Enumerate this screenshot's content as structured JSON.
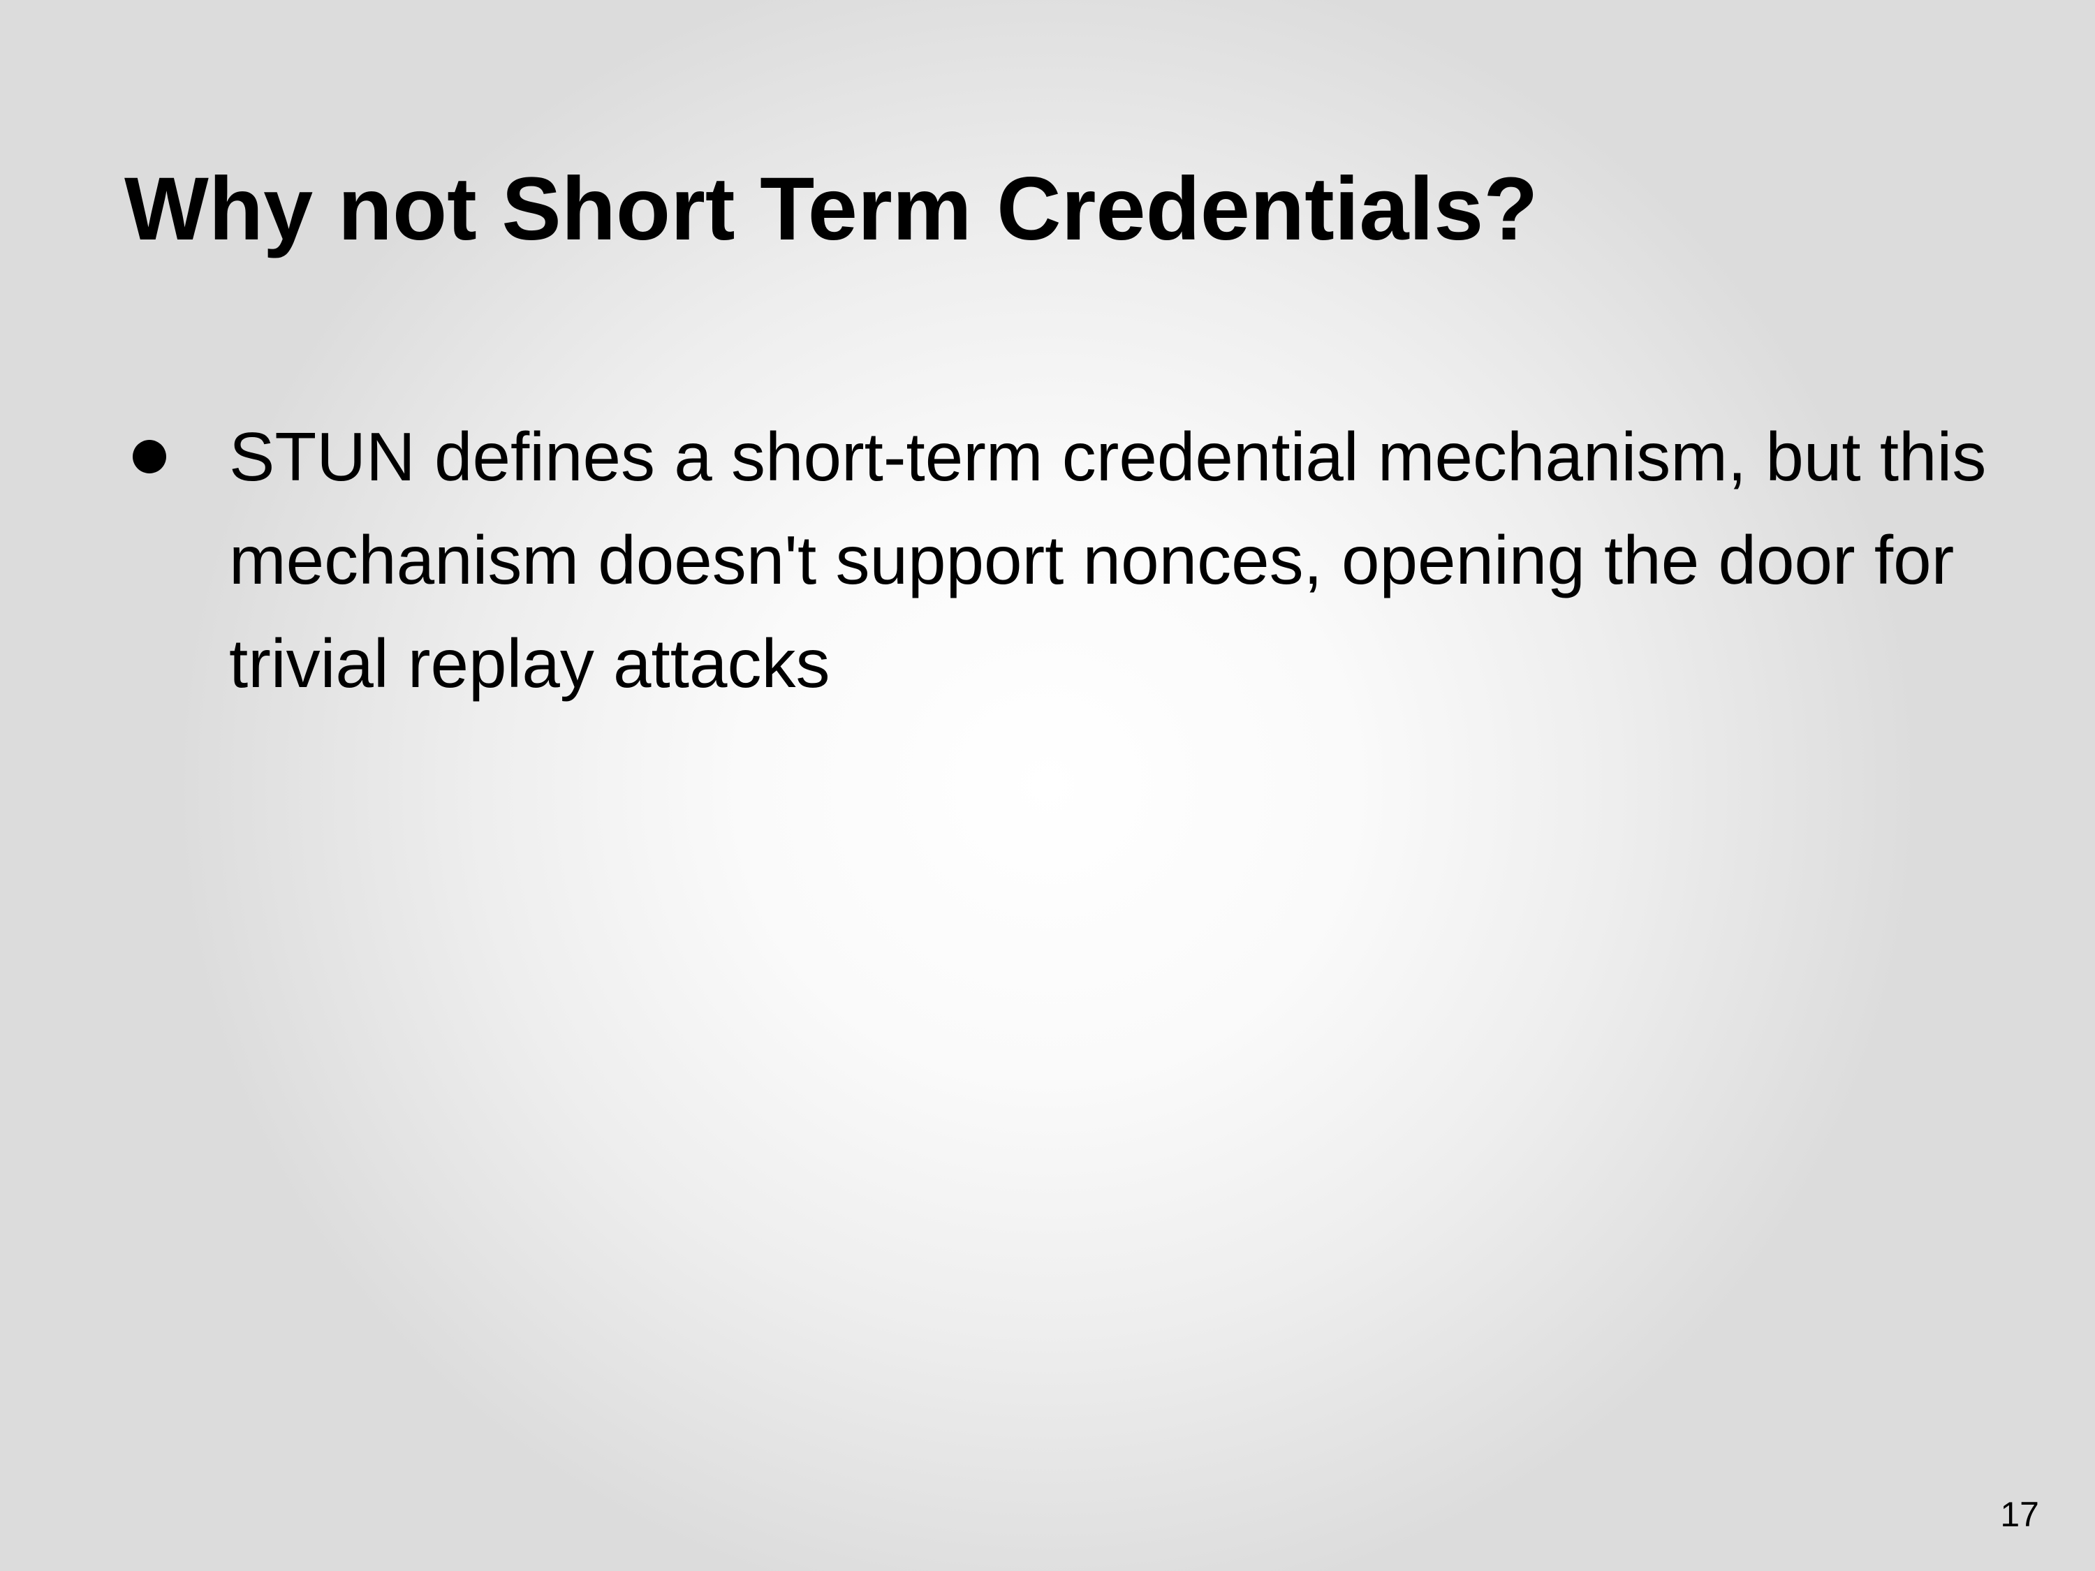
{
  "slide": {
    "title": "Why not Short Term Credentials?",
    "bullets": [
      {
        "text": "STUN defines a short-term credential mechanism, but this mechanism doesn't support nonces, opening the door for trivial replay attacks"
      }
    ],
    "page_number": "17"
  }
}
